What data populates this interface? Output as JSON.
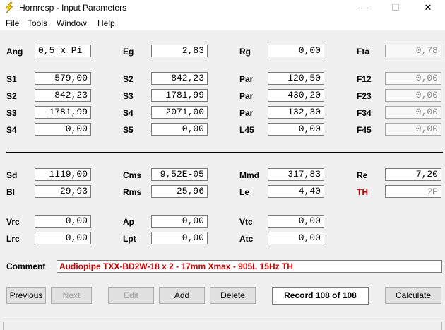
{
  "window": {
    "title": "Hornresp - Input Parameters",
    "icon": "lightning-bolt-icon",
    "min_glyph": "—",
    "max_glyph": "☐",
    "close_glyph": "✕"
  },
  "menu": {
    "file": "File",
    "tools": "Tools",
    "window": "Window",
    "help": "Help"
  },
  "params": {
    "ang": {
      "label": "Ang",
      "value": "0,5 x Pi"
    },
    "eg": {
      "label": "Eg",
      "value": "2,83"
    },
    "rg": {
      "label": "Rg",
      "value": "0,00"
    },
    "fta": {
      "label": "Fta",
      "value": "0,78"
    },
    "s1": {
      "label": "S1",
      "value": "579,00"
    },
    "s2": {
      "label": "S2",
      "value": "842,23"
    },
    "s3": {
      "label": "S3",
      "value": "1781,99"
    },
    "s4": {
      "label": "S4",
      "value": "0,00"
    },
    "s2b": {
      "label": "S2",
      "value": "842,23"
    },
    "s3b": {
      "label": "S3",
      "value": "1781,99"
    },
    "s4b": {
      "label": "S4",
      "value": "2071,00"
    },
    "s5": {
      "label": "S5",
      "value": "0,00"
    },
    "par1": {
      "label": "Par",
      "value": "120,50"
    },
    "par2": {
      "label": "Par",
      "value": "430,20"
    },
    "par3": {
      "label": "Par",
      "value": "132,30"
    },
    "l45": {
      "label": "L45",
      "value": "0,00"
    },
    "f12": {
      "label": "F12",
      "value": "0,00"
    },
    "f23": {
      "label": "F23",
      "value": "0,00"
    },
    "f34": {
      "label": "F34",
      "value": "0,00"
    },
    "f45": {
      "label": "F45",
      "value": "0,00"
    },
    "sd": {
      "label": "Sd",
      "value": "1119,00"
    },
    "bl": {
      "label": "Bl",
      "value": "29,93"
    },
    "cms": {
      "label": "Cms",
      "value": "9,52E-05"
    },
    "rms": {
      "label": "Rms",
      "value": "25,96"
    },
    "mmd": {
      "label": "Mmd",
      "value": "317,83"
    },
    "le": {
      "label": "Le",
      "value": "4,40"
    },
    "re": {
      "label": "Re",
      "value": "7,20"
    },
    "th": {
      "label": "TH",
      "value": "2P",
      "label_color": "#c00000"
    },
    "vrc": {
      "label": "Vrc",
      "value": "0,00"
    },
    "lrc": {
      "label": "Lrc",
      "value": "0,00"
    },
    "ap": {
      "label": "Ap",
      "value": "0,00"
    },
    "lpt": {
      "label": "Lpt",
      "value": "0,00"
    },
    "vtc": {
      "label": "Vtc",
      "value": "0,00"
    },
    "atc": {
      "label": "Atc",
      "value": "0,00"
    }
  },
  "comment": {
    "label": "Comment",
    "value": "Audiopipe TXX-BD2W-18 x 2 - 17mm Xmax - 905L 15Hz TH",
    "text_color": "#cc0000"
  },
  "buttons": {
    "previous": "Previous",
    "next": "Next",
    "edit": "Edit",
    "add": "Add",
    "delete": "Delete",
    "calculate": "Calculate"
  },
  "record": "Record 108 of 108"
}
